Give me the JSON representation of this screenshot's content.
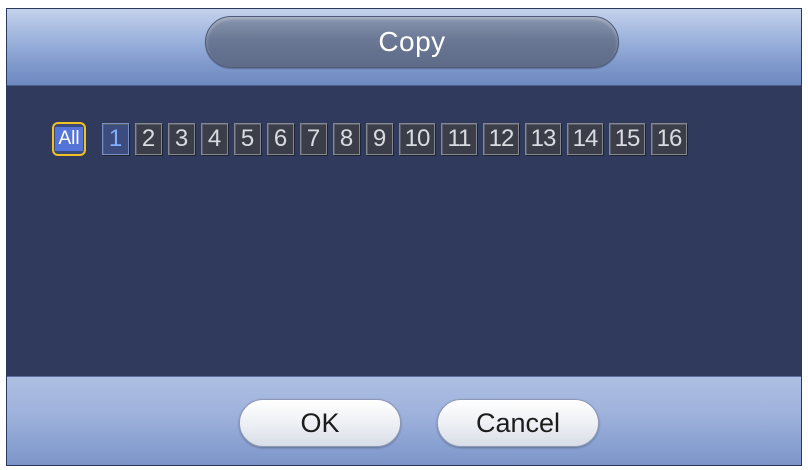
{
  "dialog": {
    "title": "Copy"
  },
  "channels": {
    "all_label": "All",
    "items": [
      "1",
      "2",
      "3",
      "4",
      "5",
      "6",
      "7",
      "8",
      "9",
      "10",
      "11",
      "12",
      "13",
      "14",
      "15",
      "16"
    ],
    "selected": "1"
  },
  "footer": {
    "ok_label": "OK",
    "cancel_label": "Cancel"
  },
  "colors": {
    "focus_border": "#f2c020",
    "dialog_body": "#2f3a5c",
    "header_gradient_top": "#c4d2ec",
    "header_gradient_bottom": "#6f8ac0"
  }
}
